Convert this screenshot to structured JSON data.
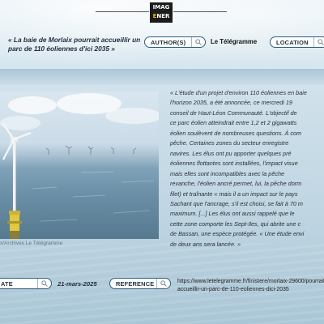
{
  "logo": {
    "line1": "IMAG",
    "line2_accent": "E",
    "line2_rest": "NER"
  },
  "article": {
    "title": "« La baie de Morlaix pourrait accueillir un parc de 110 éoliennes d'ici 2035 »",
    "body": "« L'étude d'un projet d'environ 110 éoliennes en baie\nl'horizon 2035, a été annoncée, ce mercredi 19\nconseil de Haut-Léon Communauté. L'objectif de\nce parc éolien atteindrait entre 1,2 et 2 gigawatts\néolien soulèvent de nombreuses questions. À com\npêche. Certaines zones du secteur enregistre\nnavires. Les élus ont pu apporter quelques pré\néoliennes flottantes sont installées, l'impact visue\nmais elles sont incompatibles avec la pêche\nrevanche, l'éolien ancré permet, lui, la pêche dorm\nfilet) et traînante « mais il a un impact sur le pays\nSachant que l'ancrage, s'il est choisi, se fait à 70 m\nmaximum. [...] Les élus ont aussi rappelé que le\ncette zone comporte les Sept-Iles, qui abrite une c\nde Bassan, une espèce protégée. « Une étude envi\nde deux ans sera lancée. »"
  },
  "fields": {
    "author_label": "AUTHOR(S)",
    "author_value": "Le Télégramme",
    "location_label": "LOCATION",
    "date_label": "ATE",
    "date_value": "21-mars-2025",
    "reference_label": "REFERENCE",
    "reference_value": "https://www.letelegramme.fr/finistere/morlaix-29600/pourrait-accueillir-un-parc-de-110-eoliennes-dici-2035"
  },
  "photo": {
    "caption": "x/Archives Le Télégramme"
  },
  "icons": {
    "field_icon": "search-icon"
  },
  "colors": {
    "accent": "#2f5f7f",
    "logo_bg": "#1b1b1b",
    "logo_accent": "#f4b400"
  }
}
